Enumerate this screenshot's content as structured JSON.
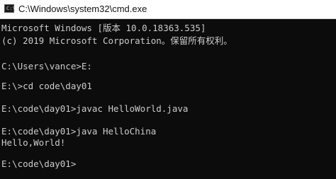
{
  "window": {
    "title": "C:\\Windows\\system32\\cmd.exe",
    "icon": "cmd-icon"
  },
  "console": {
    "lines": [
      "Microsoft Windows [版本 10.0.18363.535]",
      "(c) 2019 Microsoft Corporation。保留所有权利。",
      "",
      "C:\\Users\\vance>E:",
      "",
      "E:\\>cd code\\day01",
      "",
      "E:\\code\\day01>javac HelloWorld.java",
      "",
      "E:\\code\\day01>java HelloChina",
      "Hello,World!",
      "",
      "E:\\code\\day01>"
    ]
  },
  "colors": {
    "background": "#0c0c0c",
    "text": "#cccccc",
    "titlebar": "#ffffff"
  }
}
